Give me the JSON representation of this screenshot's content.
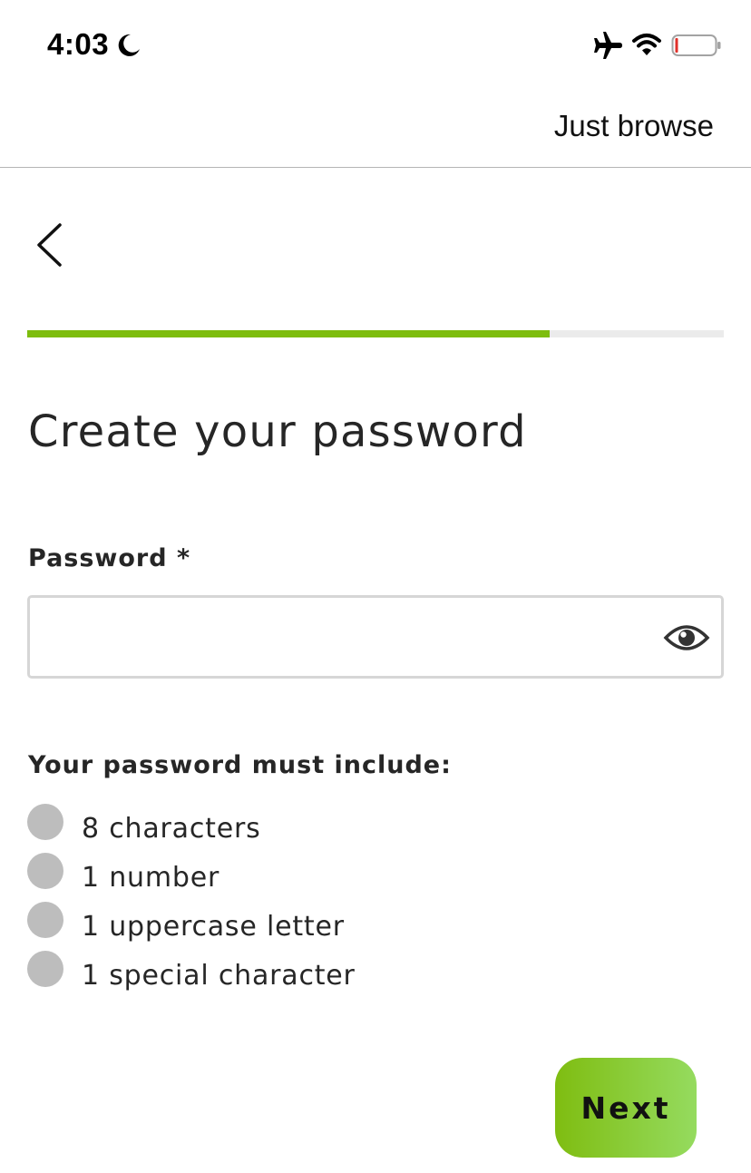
{
  "status_bar": {
    "time": "4:03",
    "icons": [
      "moon-icon",
      "airplane-icon",
      "wifi-icon",
      "battery-icon"
    ],
    "battery_low_color": "#e0302a"
  },
  "header": {
    "just_browse_label": "Just browse",
    "back_icon": "chevron-left-icon"
  },
  "progress": {
    "fraction": 0.75,
    "fill_color": "#7dbd0d",
    "track_color": "#ebebeb"
  },
  "main": {
    "title": "Create your password",
    "password_field": {
      "label": "Password *",
      "value": "",
      "toggle_icon": "eye-icon"
    },
    "requirements": {
      "title": "Your password must include:",
      "items": [
        {
          "label": "8 characters",
          "met": false
        },
        {
          "label": "1 number",
          "met": false
        },
        {
          "label": "1 uppercase letter",
          "met": false
        },
        {
          "label": "1 special character",
          "met": false
        }
      ]
    }
  },
  "footer": {
    "next_label": "Next",
    "next_gradient": [
      "#7fbd11",
      "#95db5f"
    ]
  }
}
